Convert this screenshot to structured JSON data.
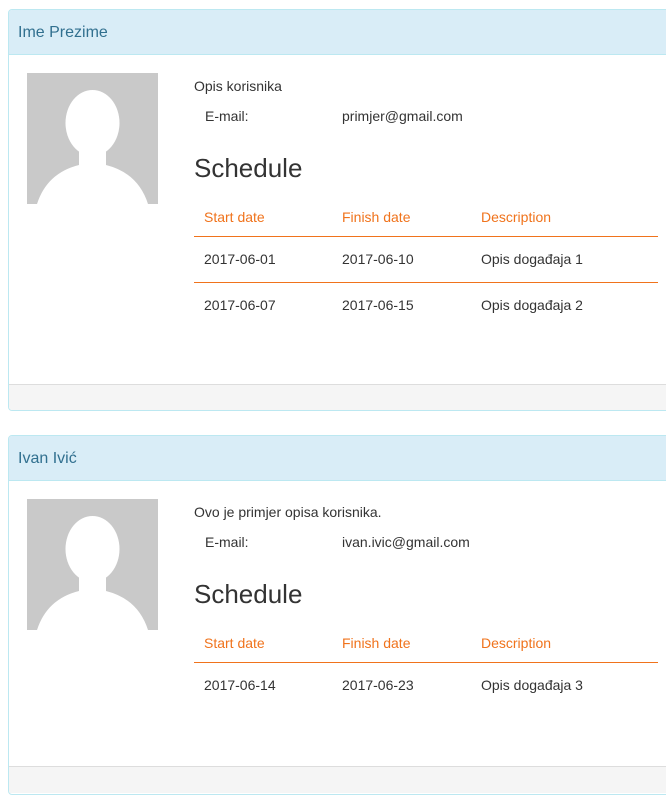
{
  "users": [
    {
      "name": "Ime Prezime",
      "description": "Opis korisnika",
      "email_label": "E-mail:",
      "email": "primjer@gmail.com",
      "schedule_title": "Schedule",
      "columns": [
        "Start date",
        "Finish date",
        "Description"
      ],
      "events": [
        {
          "start": "2017-06-01",
          "finish": "2017-06-10",
          "description": "Opis događaja 1"
        },
        {
          "start": "2017-06-07",
          "finish": "2017-06-15",
          "description": "Opis događaja 2"
        }
      ]
    },
    {
      "name": "Ivan Ivić",
      "description": "Ovo je primjer opisa korisnika.",
      "email_label": "E-mail:",
      "email": "ivan.ivic@gmail.com",
      "schedule_title": "Schedule",
      "columns": [
        "Start date",
        "Finish date",
        "Description"
      ],
      "events": [
        {
          "start": "2017-06-14",
          "finish": "2017-06-23",
          "description": "Opis događaja 3"
        }
      ]
    }
  ],
  "colors": {
    "heading_bg": "#d9edf7",
    "heading_text": "#31708f",
    "accent": "#f0731c",
    "avatar_bg": "#c9c9c9"
  }
}
